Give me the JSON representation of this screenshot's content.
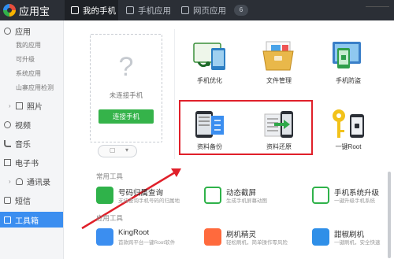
{
  "app": {
    "name": "应用宝"
  },
  "tabs": [
    {
      "label": "我的手机"
    },
    {
      "label": "手机应用"
    },
    {
      "label": "网页应用"
    }
  ],
  "tab_badge": "6",
  "sidebar": {
    "items": [
      {
        "label": "应用",
        "icon": "app-icon"
      },
      {
        "label": "照片",
        "icon": "photo-icon"
      },
      {
        "label": "视频",
        "icon": "video-icon"
      },
      {
        "label": "音乐",
        "icon": "music-icon"
      },
      {
        "label": "电子书",
        "icon": "book-icon"
      },
      {
        "label": "通讯录",
        "icon": "contacts-icon"
      },
      {
        "label": "短信",
        "icon": "sms-icon"
      },
      {
        "label": "工具箱",
        "icon": "toolbox-icon"
      }
    ],
    "sub_items": [
      {
        "label": "我的应用"
      },
      {
        "label": "可升级"
      },
      {
        "label": "系统应用"
      },
      {
        "label": "山寨应用检测"
      }
    ]
  },
  "phone_panel": {
    "status": "未连接手机",
    "connect_label": "连接手机"
  },
  "tools_grid": [
    {
      "label": "手机优化"
    },
    {
      "label": "文件管理"
    },
    {
      "label": "手机防盗"
    },
    {
      "label": "资料备份"
    },
    {
      "label": "资料还原"
    },
    {
      "label": "一键Root"
    }
  ],
  "sections": {
    "common": "常用工具",
    "apps": "应用工具"
  },
  "common_tools": [
    {
      "name": "号码归属查询",
      "desc": "支持查询手机号码的归属地"
    },
    {
      "name": "动态截屏",
      "desc": "生成手机屏幕动图"
    },
    {
      "name": "手机系统升级",
      "desc": "一键升级手机系统"
    }
  ],
  "app_tools": [
    {
      "name": "KingRoot",
      "desc": "首款跨平台一键Root软件"
    },
    {
      "name": "刷机精灵",
      "desc": "轻松刷机，简单操作零风险"
    },
    {
      "name": "甜椒刷机",
      "desc": "一键刷机，安全快速"
    }
  ],
  "colors": {
    "topbar": "#2b2f36",
    "accent": "#3b8ef0",
    "connect": "#35b34a",
    "highlight": "#e0202a"
  }
}
